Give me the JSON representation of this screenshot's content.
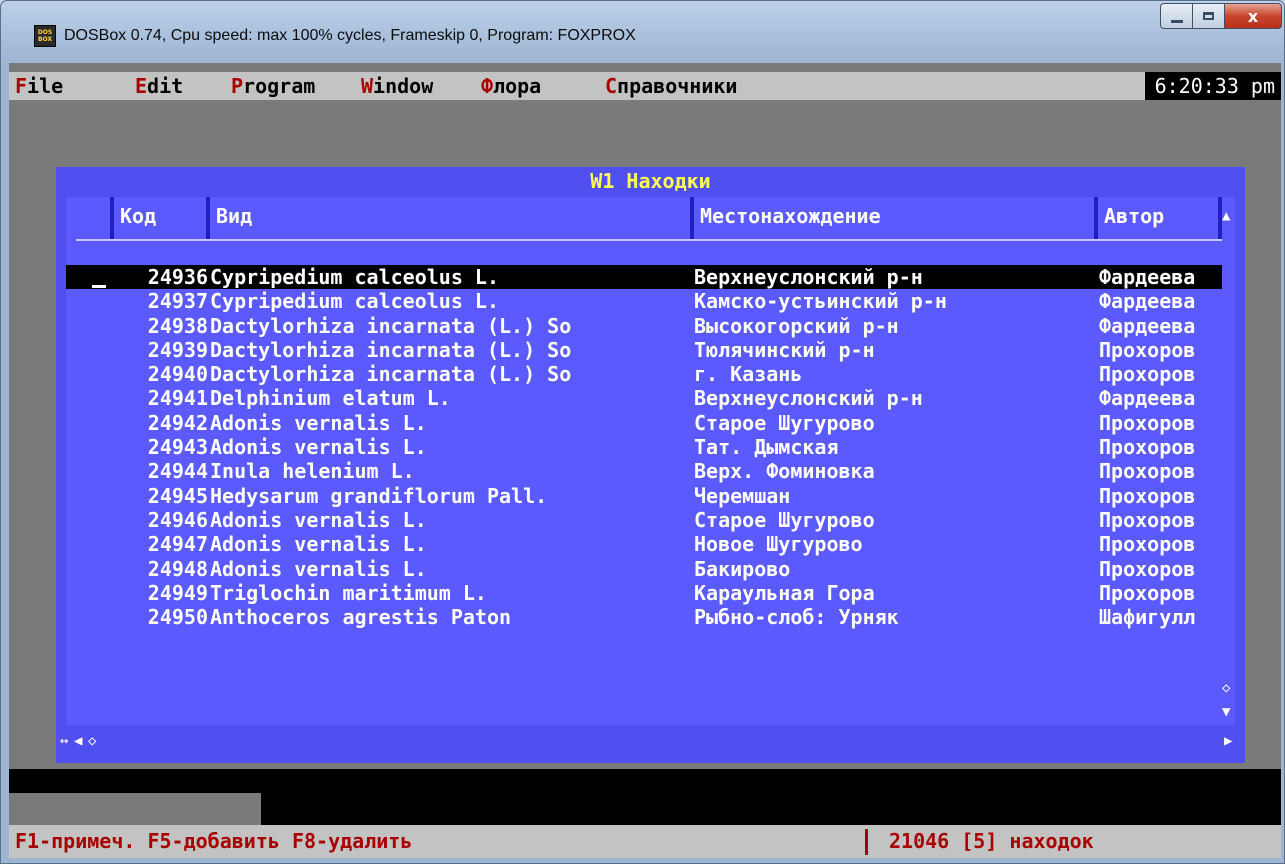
{
  "window": {
    "title": "DOSBox 0.74, Cpu speed: max 100% cycles, Frameskip  0, Program:  FOXPROX",
    "icon_text": "DOS BOX",
    "close_glyph": "x"
  },
  "menubar": {
    "items": [
      {
        "hot": "F",
        "rest": "ile"
      },
      {
        "hot": "E",
        "rest": "dit"
      },
      {
        "hot": "P",
        "rest": "rogram"
      },
      {
        "hot": "W",
        "rest": "indow"
      },
      {
        "hot": "Ф",
        "rest": "лора"
      },
      {
        "hot": "С",
        "rest": "правочники"
      }
    ],
    "clock": "6:20:33 pm"
  },
  "browse": {
    "title": "W1 Находки",
    "columns": {
      "code": "Код",
      "vid": "Вид",
      "location": "Местонахождение",
      "author": "Автор"
    },
    "cursor": "_",
    "rows": [
      {
        "code": "24936",
        "vid": "Cypripedium calceolus L.",
        "location": "Верхнеуслонский р-н",
        "author": "Фардеева",
        "selected": true
      },
      {
        "code": "24937",
        "vid": "Cypripedium calceolus L.",
        "location": "Камско-устьинский р-н",
        "author": "Фардеева"
      },
      {
        "code": "24938",
        "vid": "Dactylorhiza incarnata (L.) So",
        "location": "Высокогорский р-н",
        "author": "Фардеева"
      },
      {
        "code": "24939",
        "vid": "Dactylorhiza incarnata (L.) So",
        "location": "Тюлячинский р-н",
        "author": "Прохоров"
      },
      {
        "code": "24940",
        "vid": "Dactylorhiza incarnata (L.) So",
        "location": "г. Казань",
        "author": "Прохоров"
      },
      {
        "code": "24941",
        "vid": "Delphinium elatum L.",
        "location": "Верхнеуслонский р-н",
        "author": "Фардеева"
      },
      {
        "code": "24942",
        "vid": "Adonis vernalis L.",
        "location": "Старое Шугурово",
        "author": "Прохоров"
      },
      {
        "code": "24943",
        "vid": "Adonis vernalis L.",
        "location": "Тат. Дымская",
        "author": "Прохоров"
      },
      {
        "code": "24944",
        "vid": "Inula helenium L.",
        "location": "Верх. Фоминовка",
        "author": "Прохоров"
      },
      {
        "code": "24945",
        "vid": "Hedysarum grandiflorum Pall.",
        "location": "Черемшан",
        "author": "Прохоров"
      },
      {
        "code": "24946",
        "vid": "Adonis vernalis L.",
        "location": "Старое Шугурово",
        "author": "Прохоров"
      },
      {
        "code": "24947",
        "vid": "Adonis vernalis L.",
        "location": "Новое Шугурово",
        "author": "Прохоров"
      },
      {
        "code": "24948",
        "vid": "Adonis vernalis L.",
        "location": "Бакирово",
        "author": "Прохоров"
      },
      {
        "code": "24949",
        "vid": "Triglochin maritimum L.",
        "location": "Караульная Гора",
        "author": "Прохоров"
      },
      {
        "code": "24950",
        "vid": "Anthoceros agrestis Paton",
        "location": "Рыбно-слоб: Урняк",
        "author": "Шафигулл"
      }
    ],
    "scroll": {
      "up": "▲",
      "down": "▼",
      "thumb": "◇",
      "left": "◀",
      "right": "▶",
      "hthumb": "◇",
      "resize": "↔"
    }
  },
  "statusbar": {
    "hints": "F1-примеч. F5-добавить F8-удалить",
    "count": "21046 [5] находок"
  }
}
